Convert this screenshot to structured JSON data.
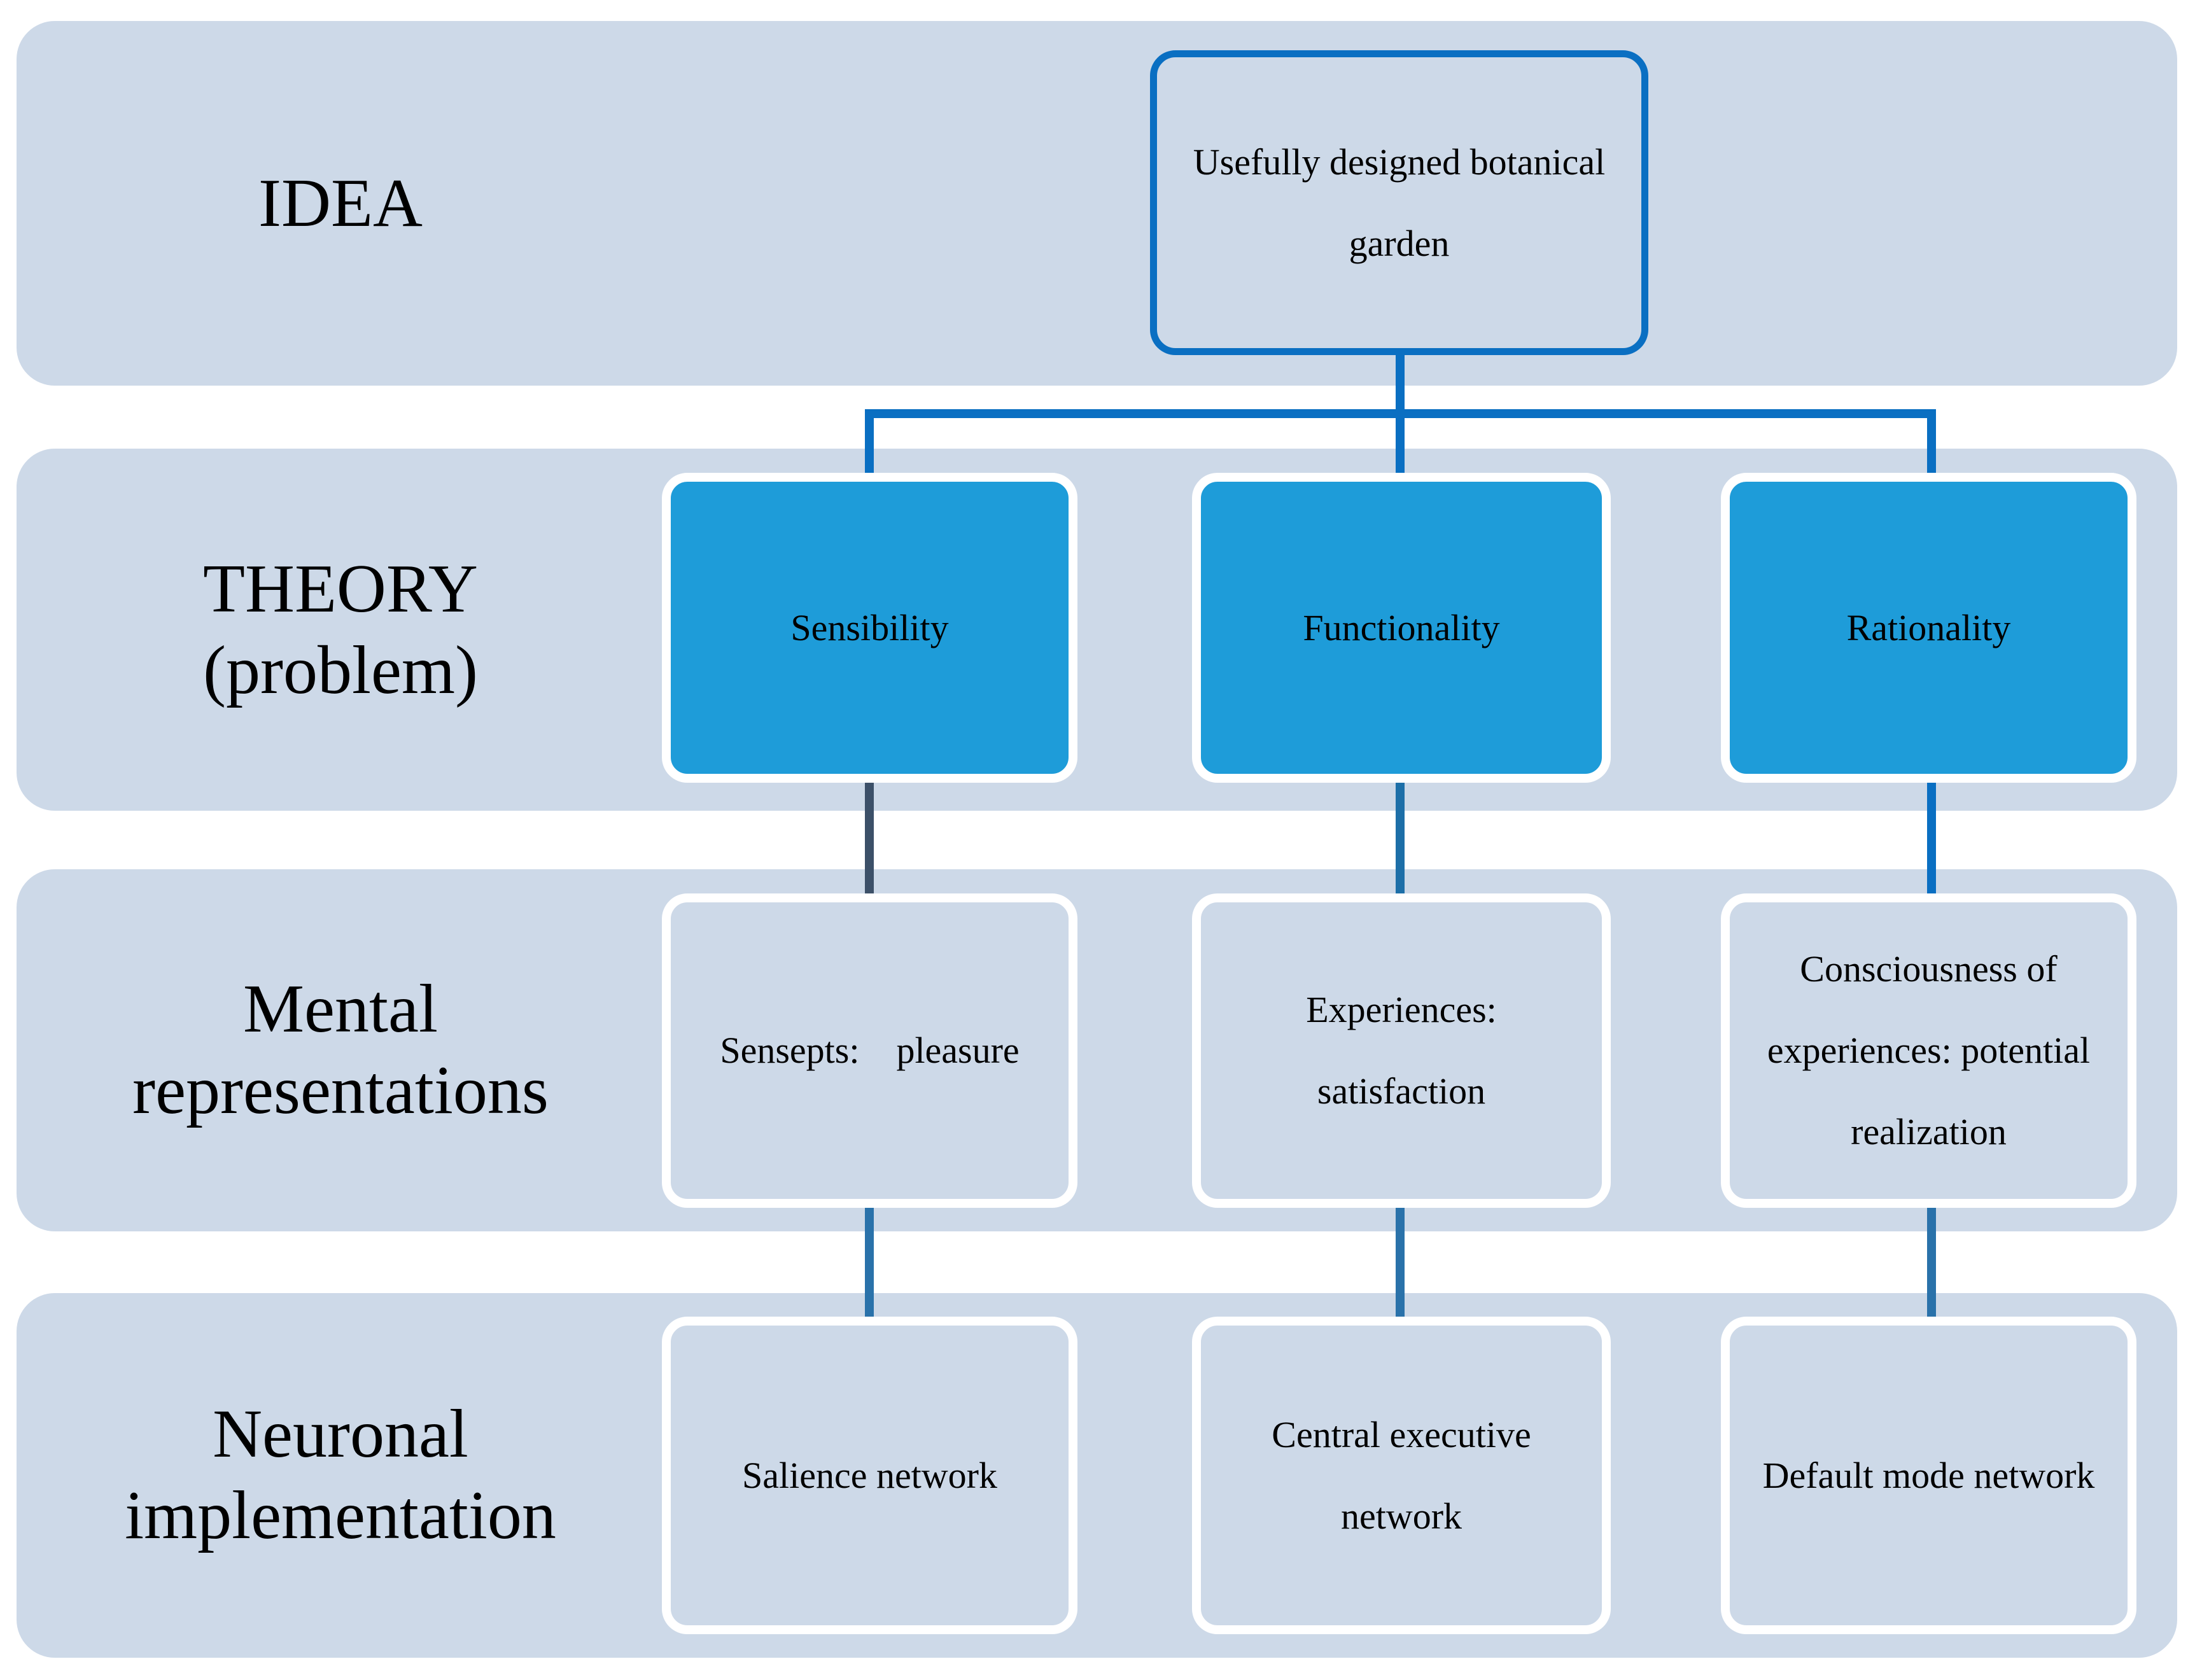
{
  "levels": {
    "idea": "IDEA",
    "theory": "THEORY\n(problem)",
    "mental": "Mental\nrepresentations",
    "neuronal": "Neuronal\nimplementation"
  },
  "idea_box": "Usefully designed botanical garden",
  "theory_boxes": [
    "Sensibility",
    "Functionality",
    "Rationality"
  ],
  "mental_boxes": [
    "Sensepts:    pleasure",
    "Experiences: satisfaction",
    "Consciousness of experiences: potential realization"
  ],
  "neuronal_boxes": [
    "Salience network",
    "Central executive network",
    "Default mode network"
  ],
  "colors": {
    "band": "#cdd9e8",
    "theory_fill": "#1e9cd9",
    "connector": "#0a6fc2",
    "idea_border": "#0a6fc2"
  }
}
